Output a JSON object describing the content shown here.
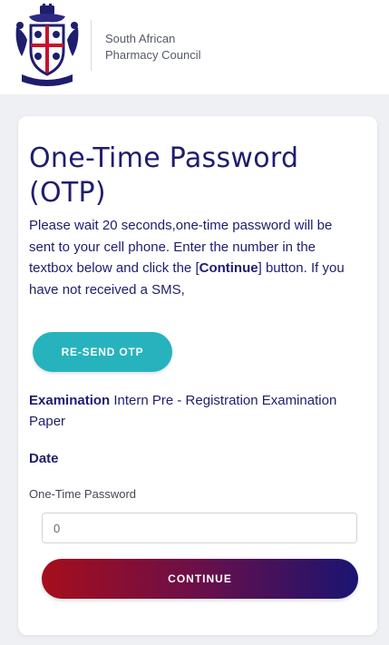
{
  "header": {
    "org_name_line1": "South African",
    "org_name_line2": "Pharmacy Council",
    "logo_icon": "coat-of-arms-crest"
  },
  "otp": {
    "title": "One-Time Password (OTP)",
    "instructions": {
      "part1": "Please wait 20 seconds,one-time password will be sent to your cell phone. Enter the number in the textbox below and click the ",
      "bracket_open": "[",
      "button_ref": "Continue",
      "bracket_close": "]",
      "part2": " button. If you have not received a SMS,"
    },
    "resend_label": "RE-SEND OTP",
    "examination_label": "Examination",
    "examination_value": " Intern Pre - Registration Examination Paper",
    "date_label": "Date",
    "field_label": "One-Time Password",
    "field_value": "0",
    "continue_label": "CONTINUE"
  },
  "colors": {
    "primary_text": "#1f1d6e",
    "resend_button": "#26b3bd",
    "continue_gradient_start": "#a60e1c",
    "continue_gradient_end": "#1a1471",
    "page_background": "#eef0f4"
  }
}
